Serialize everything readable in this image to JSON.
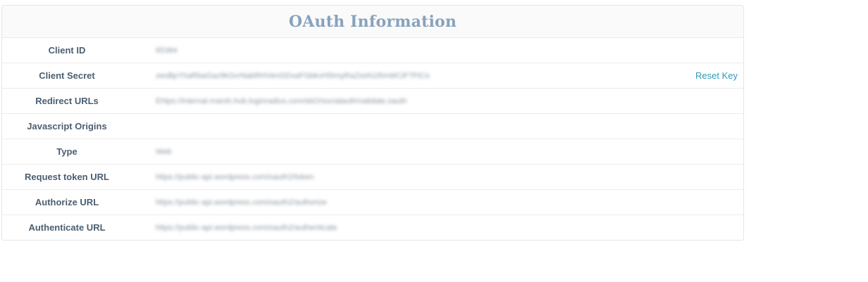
{
  "panel": {
    "title": "OAuth Information"
  },
  "rows": [
    {
      "label": "Client ID",
      "value": "65384"
    },
    {
      "label": "Client Secret",
      "value": "zeoBpYhaRbaGaz9kGvrNabRHVenGDvaFGbkvH5ImyRaZssN1i5mWCiF7FtCo",
      "action": "Reset Key"
    },
    {
      "label": "Redirect URLs",
      "value": "Ehtps://internal-marsh.hub.loginradius.com/sbO/socialauth/validate.oauth"
    },
    {
      "label": "Javascript Origins",
      "value": ""
    },
    {
      "label": "Type",
      "value": "Web"
    },
    {
      "label": "Request token URL",
      "value": "https://public-api.wordpress.com/oauth2/token"
    },
    {
      "label": "Authorize URL",
      "value": "https://public-api.wordpress.com/oauth2/authorize"
    },
    {
      "label": "Authenticate URL",
      "value": "https://public-api.wordpress.com/oauth2/authenticate"
    }
  ]
}
